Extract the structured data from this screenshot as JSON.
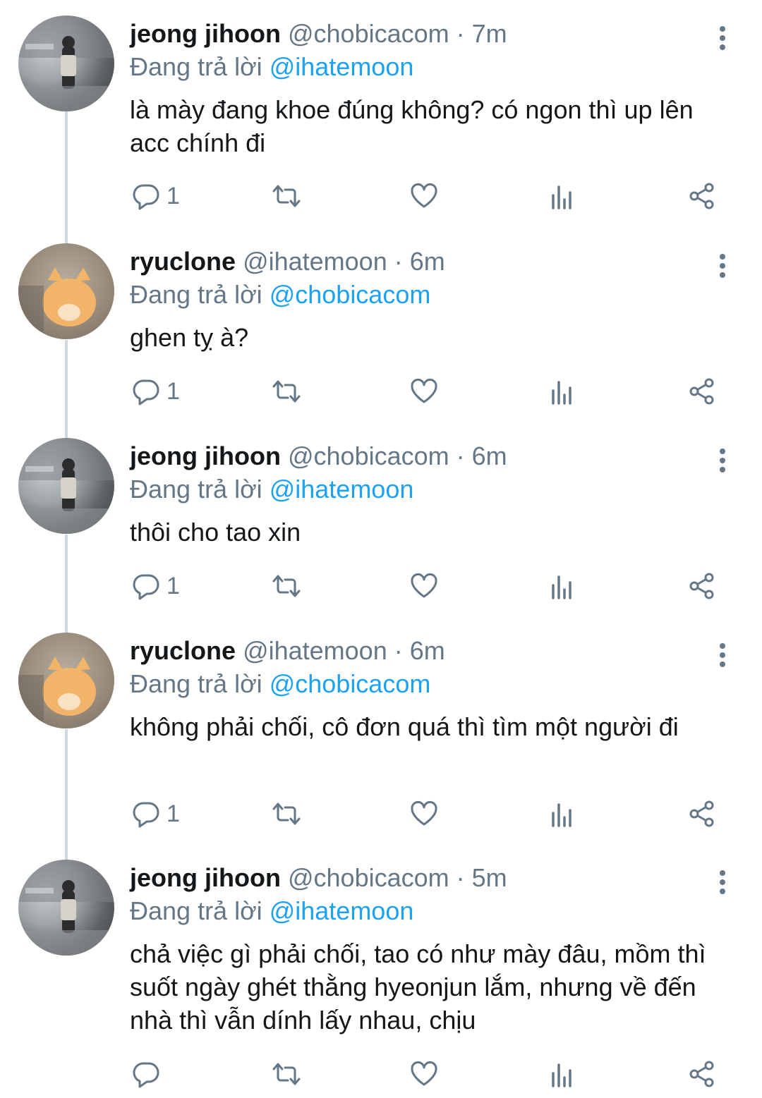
{
  "replying_prefix": "Đang trả lời",
  "tweets": [
    {
      "name": "jeong jihoon",
      "handle": "@chobicacom",
      "time": "7m",
      "separator": "·",
      "replying_to": "@ihatemoon",
      "text": "là mày đang khoe đúng không? có ngon thì up lên acc chính đi",
      "reply_count": "1",
      "avatar": "jihoon-photo"
    },
    {
      "name": "ryuclone",
      "handle": "@ihatemoon",
      "time": "6m",
      "separator": "·",
      "replying_to": "@chobicacom",
      "text": "ghen tỵ à?",
      "reply_count": "1",
      "avatar": "corgi-photo"
    },
    {
      "name": "jeong jihoon",
      "handle": "@chobicacom",
      "time": "6m",
      "separator": "·",
      "replying_to": "@ihatemoon",
      "text": "thôi cho tao xin",
      "reply_count": "1",
      "avatar": "jihoon-photo"
    },
    {
      "name": "ryuclone",
      "handle": "@ihatemoon",
      "time": "6m",
      "separator": "·",
      "replying_to": "@chobicacom",
      "text": "không phải chối, cô đơn quá thì tìm một người đi",
      "reply_count": "1",
      "avatar": "corgi-photo"
    },
    {
      "name": "jeong jihoon",
      "handle": "@chobicacom",
      "time": "5m",
      "separator": "·",
      "replying_to": "@ihatemoon",
      "text": "chả việc gì phải chối, tao có như mày đâu, mồm thì suốt ngày ghét thằng hyeonjun lắm, nhưng về đến nhà thì vẫn dính lấy nhau, chịu",
      "reply_count": "",
      "avatar": "jihoon-photo"
    }
  ],
  "icons": {
    "reply": "reply-icon",
    "retweet": "retweet-icon",
    "like": "heart-icon",
    "analytics": "analytics-icon",
    "share": "share-icon",
    "more": "more-vertical-icon"
  },
  "colors": {
    "mention": "#1da1f2",
    "secondary_text": "#657786",
    "thread_line": "#cfd9de"
  }
}
